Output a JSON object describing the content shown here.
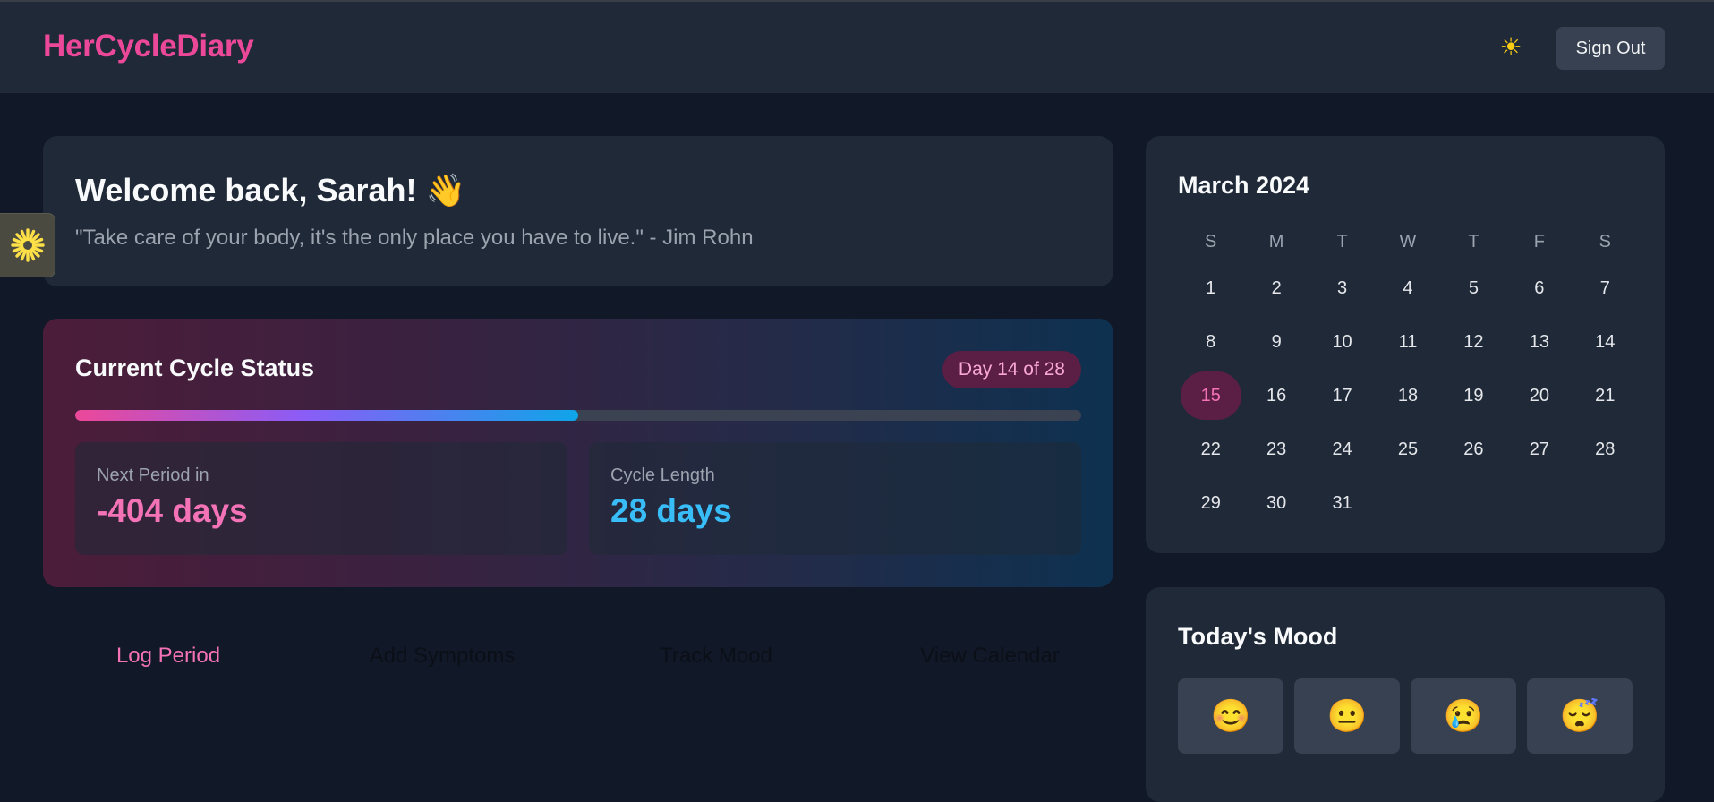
{
  "header": {
    "app_title": "HerCycleDiary",
    "theme_icon": "sun-icon",
    "theme_glyph": "☀",
    "sign_out_label": "Sign Out"
  },
  "side_tab": {
    "icon": "asterisk-icon",
    "color": "#fde047"
  },
  "welcome": {
    "heading": "Welcome back, Sarah! 👋",
    "quote": "\"Take care of your body, it's the only place you have to live.\" - Jim Rohn"
  },
  "cycle_status": {
    "title": "Current Cycle Status",
    "day_badge": "Day 14 of 28",
    "progress_fraction": 0.5,
    "next_period": {
      "label": "Next Period in",
      "value": "-404 days"
    },
    "cycle_length": {
      "label": "Cycle Length",
      "value": "28 days"
    }
  },
  "quick_actions": [
    "Log Period",
    "Add Symptoms",
    "Track Mood",
    "View Calendar"
  ],
  "calendar": {
    "month_title": "March 2024",
    "weekdays": [
      "S",
      "M",
      "T",
      "W",
      "T",
      "F",
      "S"
    ],
    "days": [
      "1",
      "2",
      "3",
      "4",
      "5",
      "6",
      "7",
      "8",
      "9",
      "10",
      "11",
      "12",
      "13",
      "14",
      "15",
      "16",
      "17",
      "18",
      "19",
      "20",
      "21",
      "22",
      "23",
      "24",
      "25",
      "26",
      "27",
      "28",
      "29",
      "30",
      "31"
    ],
    "today": "15"
  },
  "mood": {
    "title": "Today's Mood",
    "options": [
      {
        "emoji": "😊",
        "icon": "happy-face-icon"
      },
      {
        "emoji": "😐",
        "icon": "neutral-face-icon"
      },
      {
        "emoji": "😢",
        "icon": "crying-face-icon"
      },
      {
        "emoji": "😴",
        "icon": "sleepy-face-icon"
      }
    ]
  },
  "colors": {
    "brand_pink": "#ec4899",
    "accent_blue": "#38bdf8",
    "background": "#111827",
    "card": "#1f2937"
  }
}
